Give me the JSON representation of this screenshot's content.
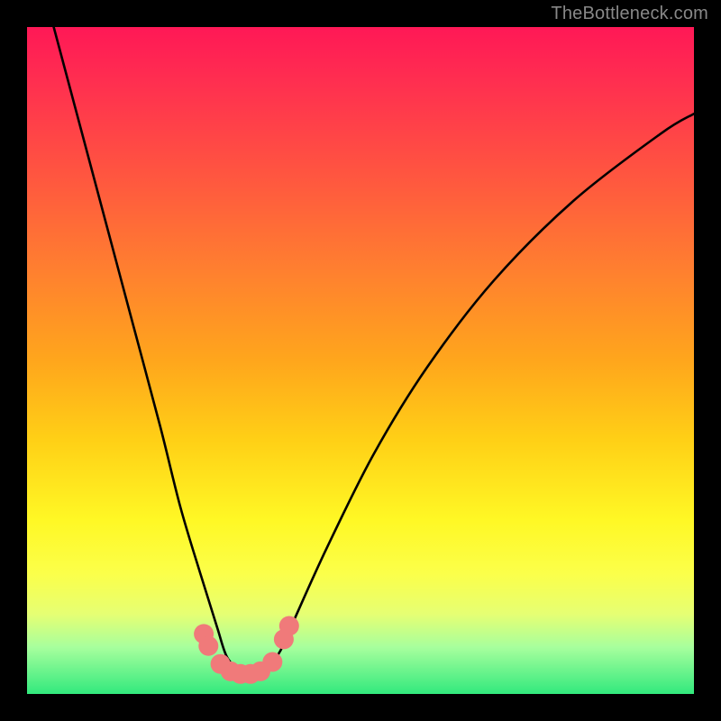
{
  "watermark": "TheBottleneck.com",
  "chart_data": {
    "type": "line",
    "title": "",
    "xlabel": "",
    "ylabel": "",
    "xlim": [
      0,
      100
    ],
    "ylim": [
      0,
      100
    ],
    "series": [
      {
        "name": "bottleneck-curve",
        "x": [
          4,
          8,
          12,
          16,
          20,
          23,
          26,
          28.5,
          30,
          32,
          34,
          36,
          38,
          40,
          45,
          52,
          60,
          70,
          82,
          95,
          100
        ],
        "y": [
          100,
          85,
          70,
          55,
          40,
          28,
          18,
          10,
          5.5,
          3.5,
          3,
          3.8,
          6.5,
          11,
          22,
          36,
          49,
          62,
          74,
          84,
          87
        ]
      }
    ],
    "markers": {
      "name": "datapoints-pink",
      "color": "#f07a7a",
      "points": [
        {
          "x": 26.5,
          "y": 9.0
        },
        {
          "x": 27.2,
          "y": 7.2
        },
        {
          "x": 29.0,
          "y": 4.5
        },
        {
          "x": 30.5,
          "y": 3.4
        },
        {
          "x": 32.0,
          "y": 3.0
        },
        {
          "x": 33.5,
          "y": 3.0
        },
        {
          "x": 35.0,
          "y": 3.4
        },
        {
          "x": 36.8,
          "y": 4.8
        },
        {
          "x": 38.5,
          "y": 8.2
        },
        {
          "x": 39.3,
          "y": 10.2
        }
      ]
    },
    "background_gradient": {
      "type": "vertical",
      "stops": [
        {
          "pos": 0.0,
          "color": "#ff1856"
        },
        {
          "pos": 0.5,
          "color": "#ffa61c"
        },
        {
          "pos": 0.78,
          "color": "#fff825"
        },
        {
          "pos": 1.0,
          "color": "#32e97d"
        }
      ]
    }
  }
}
